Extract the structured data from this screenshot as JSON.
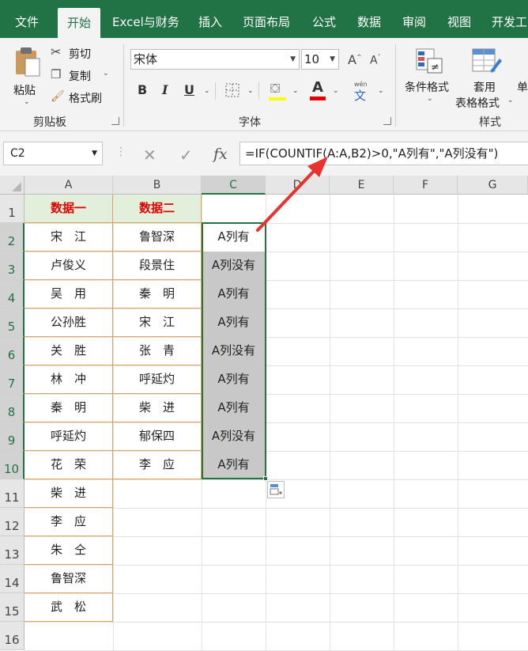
{
  "ribbon_tabs": [
    "文件",
    "开始",
    "Excel与财务",
    "插入",
    "页面布局",
    "公式",
    "数据",
    "审阅",
    "视图",
    "开发工"
  ],
  "clipboard": {
    "paste": "粘贴",
    "cut": "剪切",
    "copy": "复制",
    "format_painter": "格式刷",
    "group": "剪贴板"
  },
  "font": {
    "name": "宋体",
    "size": "10",
    "bold": "B",
    "italic": "I",
    "underline": "U",
    "color_glyph": "A",
    "grow": "A",
    "shrink": "A",
    "wen": "wén",
    "wen_char": "文",
    "group": "字体"
  },
  "styles": {
    "conditional": "条件格式",
    "table1": "套用",
    "table2": "表格格式",
    "cell_styles": "单",
    "group": "样式"
  },
  "name_box": "C2",
  "formula": "=IF(COUNTIF(A:A,B2)>0,\"A列有\",\"A列没有\")",
  "fx": "fx",
  "columns": [
    "A",
    "B",
    "C",
    "D",
    "E",
    "F",
    "G"
  ],
  "rows": [
    "1",
    "2",
    "3",
    "4",
    "5",
    "6",
    "7",
    "8",
    "9",
    "10",
    "11",
    "12",
    "13",
    "14",
    "15",
    "16"
  ],
  "col_a": [
    "数据一",
    "宋　江",
    "卢俊义",
    "吴　用",
    "公孙胜",
    "关　胜",
    "林　冲",
    "秦　明",
    "呼延灼",
    "花　荣",
    "柴　进",
    "李　应",
    "朱　仝",
    "鲁智深",
    "武　松"
  ],
  "col_b": [
    "数据二",
    "鲁智深",
    "段景住",
    "秦　明",
    "宋　江",
    "张　青",
    "呼延灼",
    "柴　进",
    "郁保四",
    "李　应"
  ],
  "col_c": [
    "",
    "A列有",
    "A列没有",
    "A列有",
    "A列有",
    "A列没有",
    "A列有",
    "A列有",
    "A列没有",
    "A列有"
  ],
  "colors": {
    "excel_green": "#217346",
    "header_fill": "#e2efda",
    "header_text": "#e00000",
    "result_fill": "#c8c8c8",
    "arrow": "#e8322d",
    "table_border": "#e0a35a"
  }
}
